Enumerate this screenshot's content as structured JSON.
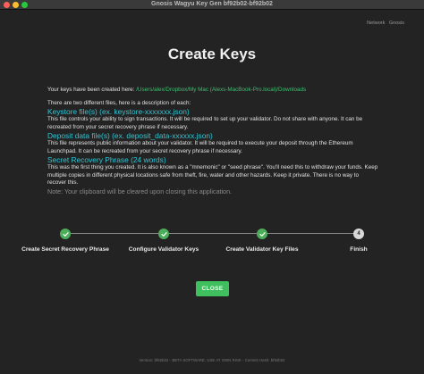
{
  "window": {
    "title": "Gnosis Wagyu Key Gen bf92b02-bf92b02"
  },
  "network": {
    "label": "Network",
    "value": "Gnosis"
  },
  "page": {
    "heading": "Create Keys",
    "created_prefix": "Your keys have been created here:",
    "created_path": "/Users/alex/Dropbox/My Mac (Alexs-MacBook-Pro.local)/Downloads",
    "description_intro": "There are two different files, here is a description of each:",
    "keystore_title": "Keystore file(s) (ex. keystore-xxxxxxx.json)",
    "keystore_desc": "This file controls your ability to sign transactions. It will be required to set up your validator. Do not share with anyone. It can be recreated from your secret recovery phrase if necessary.",
    "deposit_title": "Deposit data file(s) (ex. deposit_data-xxxxxx.json)",
    "deposit_desc": "This file represents public information about your validator. It will be required to execute your deposit through the Ethereum Launchpad. It can be recreated from your secret recovery phrase if necessary.",
    "srp_title": "Secret Recovery Phrase (24 words)",
    "srp_desc": "This was the first thing you created. It is also known as a \"mnemonic\" or \"seed phrase\". You'll need this to withdraw your funds. Keep multiple copies in different physical locations safe from theft, fire, water and other hazards. Keep it private. There is no way to recover this.",
    "clipboard_note": "Note: Your clipboard will be cleared upon closing this application."
  },
  "stepper": {
    "steps": [
      {
        "label": "Create Secret Recovery Phrase",
        "state": "complete",
        "icon": "check-icon"
      },
      {
        "label": "Configure Validator Keys",
        "state": "complete",
        "icon": "check-icon"
      },
      {
        "label": "Create Validator Key Files",
        "state": "complete",
        "icon": "check-icon"
      },
      {
        "label": "Finish",
        "state": "active",
        "number": "4"
      }
    ]
  },
  "actions": {
    "close_label": "CLOSE"
  },
  "footer": {
    "text": "Version: bf92b02 - BETA SOFTWARE, USE AT OWN RISK - Commit Hash: bf92b02"
  },
  "colors": {
    "accent_green": "#3fbf5e",
    "step_complete": "#4cae5a",
    "heading_cyan": "#2fc7d6",
    "path_green": "#3fbf72",
    "background": "#232323"
  }
}
